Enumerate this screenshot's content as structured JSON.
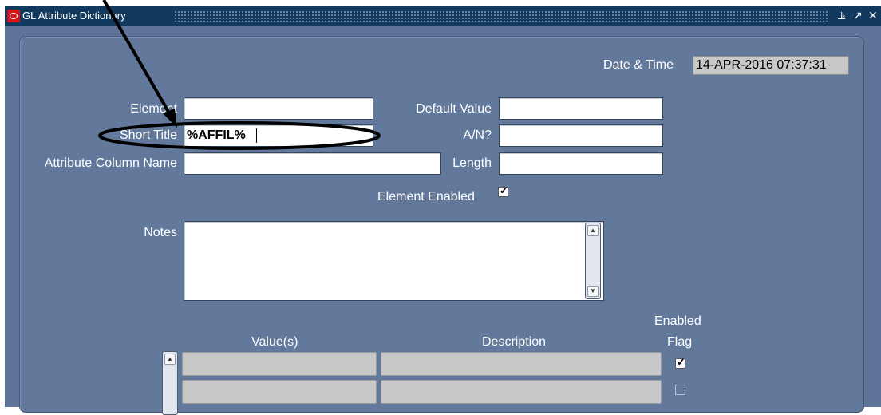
{
  "window": {
    "title": "GL Attribute Dictionary",
    "controls": [
      "minimize-icon",
      "maximize-icon",
      "close-icon"
    ],
    "minimize_glyph": "⫡",
    "maximize_glyph": "↗",
    "close_glyph": "✕"
  },
  "header": {
    "datetime_label": "Date & Time",
    "datetime_value": "14-APR-2016 07:37:31"
  },
  "form": {
    "element_label": "Element",
    "element_value": "",
    "short_title_label": "Short Title",
    "short_title_value": "%AFFIL%",
    "attribute_column_label": "Attribute Column Name",
    "attribute_column_value": "",
    "default_value_label": "Default Value",
    "default_value_value": "",
    "an_label": "A/N?",
    "an_value": "",
    "length_label": "Length",
    "length_value": "",
    "element_enabled_label": "Element Enabled",
    "element_enabled_checked": true,
    "notes_label": "Notes",
    "notes_value": ""
  },
  "grid": {
    "headers": {
      "values": "Value(s)",
      "description": "Description",
      "enabled_line1": "Enabled",
      "enabled_line2": "Flag"
    },
    "rows": [
      {
        "value": "",
        "description": "",
        "enabled": true
      },
      {
        "value": "",
        "description": "",
        "enabled": false
      }
    ]
  },
  "colors": {
    "titlebar": "#123a5e",
    "form_bg": "#62799b",
    "field_bg": "#ffffff",
    "readonly_bg": "#c8c8c8"
  }
}
